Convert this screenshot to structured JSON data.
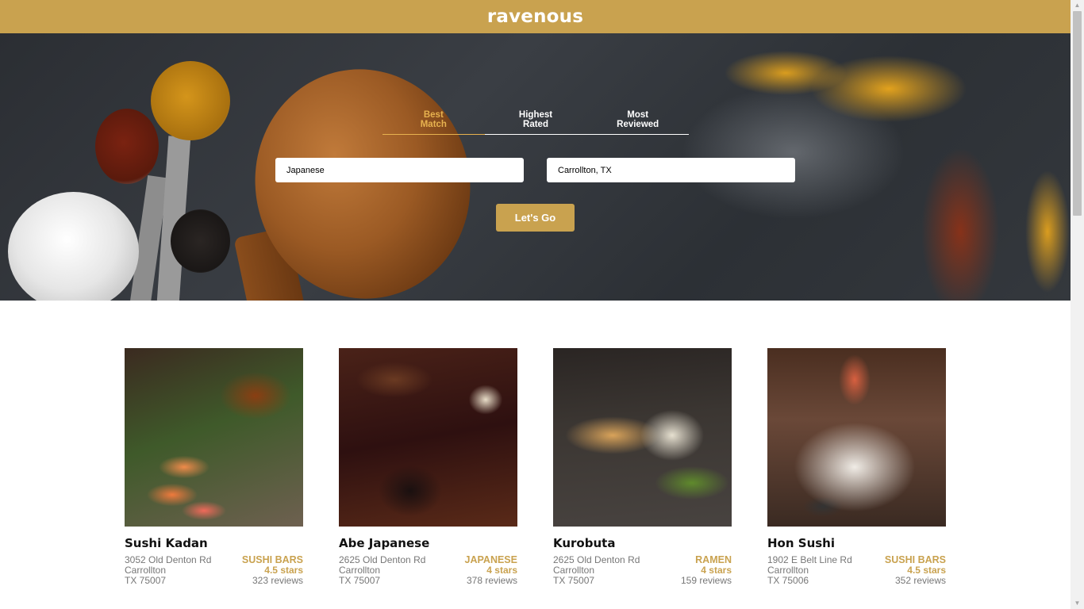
{
  "header": {
    "brand": "ravenous"
  },
  "search": {
    "sort_options": [
      {
        "label": "Best\nMatch",
        "active": true
      },
      {
        "label": "Highest\nRated",
        "active": false
      },
      {
        "label": "Most\nReviewed",
        "active": false
      }
    ],
    "term_value": "Japanese",
    "location_value": "Carrollton, TX",
    "submit_label": "Let's Go"
  },
  "businesses": [
    {
      "name": "Sushi Kadan",
      "address": "3052 Old Denton Rd",
      "city": "Carrollton",
      "state_zip": "TX 75007",
      "category": "SUSHI BARS",
      "rating": "4.5 stars",
      "reviews": "323 reviews"
    },
    {
      "name": "Abe Japanese",
      "address": "2625 Old Denton Rd",
      "city": "Carrollton",
      "state_zip": "TX 75007",
      "category": "JAPANESE",
      "rating": "4 stars",
      "reviews": "378 reviews"
    },
    {
      "name": "Kurobuta",
      "address": "2625 Old Denton Rd",
      "city": "Carrollton",
      "state_zip": "TX 75007",
      "category": "RAMEN",
      "rating": "4 stars",
      "reviews": "159 reviews"
    },
    {
      "name": "Hon Sushi",
      "address": "1902 E Belt Line Rd",
      "city": "Carrollton",
      "state_zip": "TX 75006",
      "category": "SUSHI BARS",
      "rating": "4.5 stars",
      "reviews": "352 reviews"
    }
  ],
  "colors": {
    "brand": "#c9a24f",
    "active_tab": "#e7b24f"
  }
}
